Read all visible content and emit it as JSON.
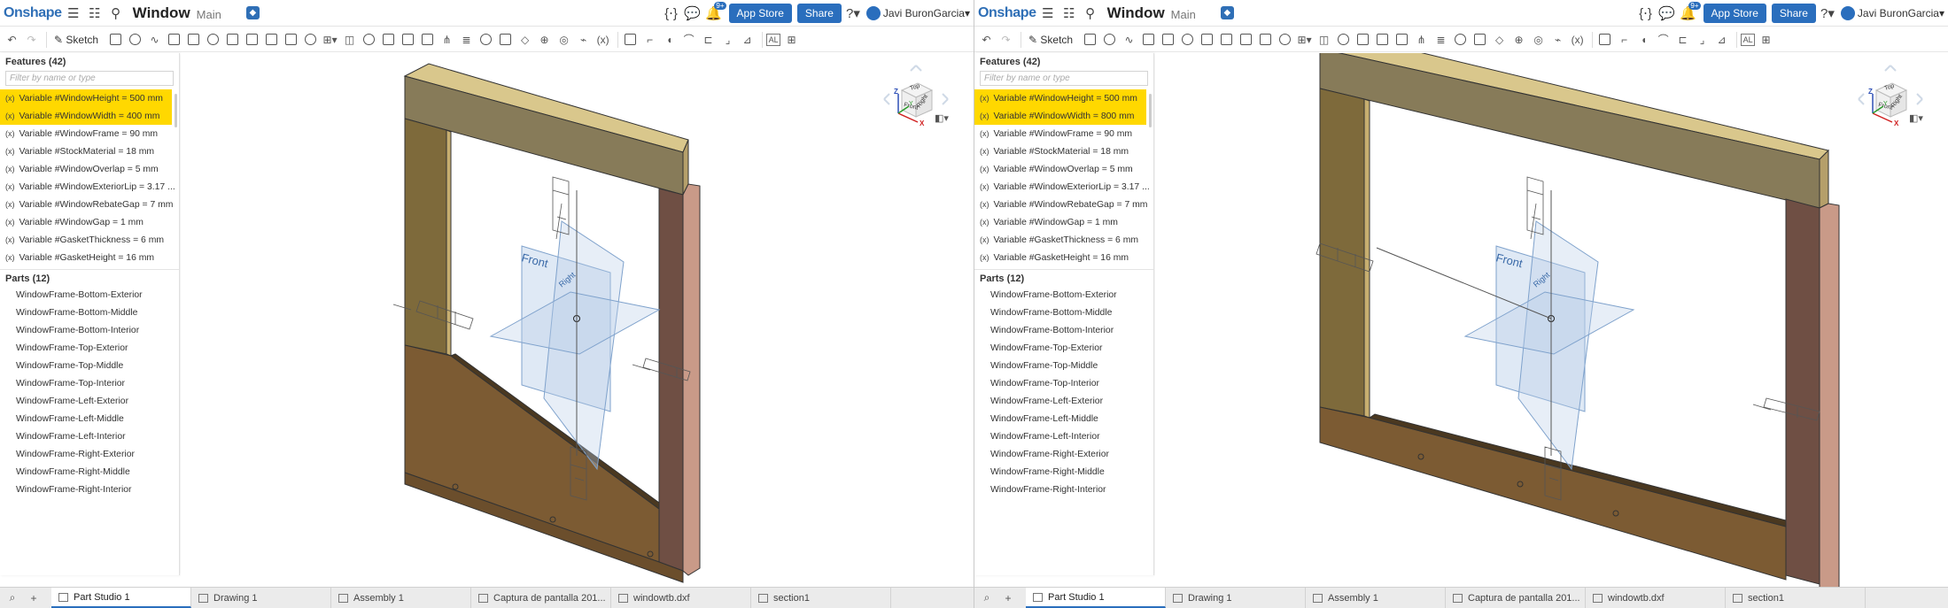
{
  "panes": [
    {
      "header": {
        "logo": "Onshape",
        "title": "Window",
        "workspace": "Main",
        "app_store": "App Store",
        "share": "Share",
        "notifications": "9+",
        "user": "Javi BuronGarcia"
      },
      "toolbar": {
        "sketch_label": "Sketch",
        "al_label": "AL"
      },
      "features": {
        "header": "Features (42)",
        "filter_placeholder": "Filter by name or type",
        "items": [
          {
            "label": "Variable #WindowHeight = 500 mm",
            "selected": true
          },
          {
            "label": "Variable #WindowWidth = 400 mm",
            "selected": true
          },
          {
            "label": "Variable #WindowFrame = 90 mm",
            "selected": false
          },
          {
            "label": "Variable #StockMaterial = 18 mm",
            "selected": false
          },
          {
            "label": "Variable #WindowOverlap = 5 mm",
            "selected": false
          },
          {
            "label": "Variable #WindowExteriorLip = 3.17 ...",
            "selected": false
          },
          {
            "label": "Variable #WindowRebateGap = 7 mm",
            "selected": false
          },
          {
            "label": "Variable #WindowGap = 1 mm",
            "selected": false
          },
          {
            "label": "Variable #GasketThickness = 6 mm",
            "selected": false
          },
          {
            "label": "Variable #GasketHeight = 16 mm",
            "selected": false
          }
        ]
      },
      "parts": {
        "header": "Parts (12)",
        "items": [
          "WindowFrame-Bottom-Exterior",
          "WindowFrame-Bottom-Middle",
          "WindowFrame-Bottom-Interior",
          "WindowFrame-Top-Exterior",
          "WindowFrame-Top-Middle",
          "WindowFrame-Top-Interior",
          "WindowFrame-Left-Exterior",
          "WindowFrame-Left-Middle",
          "WindowFrame-Left-Interior",
          "WindowFrame-Right-Exterior",
          "WindowFrame-Right-Middle",
          "WindowFrame-Right-Interior"
        ]
      },
      "viewcube": {
        "front": "Front",
        "top": "Top",
        "right": "Right",
        "axis_x": "X",
        "axis_y": "Y",
        "axis_z": "Z"
      },
      "plane_label": "Front",
      "plane_label_2": "Right",
      "tabs": [
        {
          "label": "Part Studio 1",
          "active": true
        },
        {
          "label": "Drawing 1",
          "active": false
        },
        {
          "label": "Assembly 1",
          "active": false
        },
        {
          "label": "Captura de pantalla 201...",
          "active": false
        },
        {
          "label": "windowtb.dxf",
          "active": false
        },
        {
          "label": "section1",
          "active": false
        }
      ]
    },
    {
      "header": {
        "logo": "Onshape",
        "title": "Window",
        "workspace": "Main",
        "app_store": "App Store",
        "share": "Share",
        "notifications": "9+",
        "user": "Javi BuronGarcia"
      },
      "toolbar": {
        "sketch_label": "Sketch",
        "al_label": "AL"
      },
      "features": {
        "header": "Features (42)",
        "filter_placeholder": "Filter by name or type",
        "items": [
          {
            "label": "Variable #WindowHeight = 500 mm",
            "selected": true
          },
          {
            "label": "Variable #WindowWidth = 800 mm",
            "selected": true
          },
          {
            "label": "Variable #WindowFrame = 90 mm",
            "selected": false
          },
          {
            "label": "Variable #StockMaterial = 18 mm",
            "selected": false
          },
          {
            "label": "Variable #WindowOverlap = 5 mm",
            "selected": false
          },
          {
            "label": "Variable #WindowExteriorLip = 3.17 ...",
            "selected": false
          },
          {
            "label": "Variable #WindowRebateGap = 7 mm",
            "selected": false
          },
          {
            "label": "Variable #WindowGap = 1 mm",
            "selected": false
          },
          {
            "label": "Variable #GasketThickness = 6 mm",
            "selected": false
          },
          {
            "label": "Variable #GasketHeight = 16 mm",
            "selected": false
          }
        ]
      },
      "parts": {
        "header": "Parts (12)",
        "items": [
          "WindowFrame-Bottom-Exterior",
          "WindowFrame-Bottom-Middle",
          "WindowFrame-Bottom-Interior",
          "WindowFrame-Top-Exterior",
          "WindowFrame-Top-Middle",
          "WindowFrame-Top-Interior",
          "WindowFrame-Left-Exterior",
          "WindowFrame-Left-Middle",
          "WindowFrame-Left-Interior",
          "WindowFrame-Right-Exterior",
          "WindowFrame-Right-Middle",
          "WindowFrame-Right-Interior"
        ]
      },
      "viewcube": {
        "front": "Front",
        "top": "Top",
        "right": "Right",
        "axis_x": "X",
        "axis_y": "Y",
        "axis_z": "Z"
      },
      "plane_label": "Front",
      "plane_label_2": "Right",
      "tabs": [
        {
          "label": "Part Studio 1",
          "active": true
        },
        {
          "label": "Drawing 1",
          "active": false
        },
        {
          "label": "Assembly 1",
          "active": false
        },
        {
          "label": "Captura de pantalla 201...",
          "active": false
        },
        {
          "label": "windowtb.dxf",
          "active": false
        },
        {
          "label": "section1",
          "active": false
        }
      ]
    }
  ],
  "colors": {
    "accent": "#2a6ebd",
    "selection": "#ffd800",
    "frame_top": "#8a7f5c",
    "frame_top_face": "#d7c48a",
    "frame_left": "#7f6a3a",
    "frame_bottom": "#7a5a32",
    "frame_right": "#6f4d42",
    "frame_right_edge": "#c99a88",
    "plane": "#b9cfe8"
  }
}
